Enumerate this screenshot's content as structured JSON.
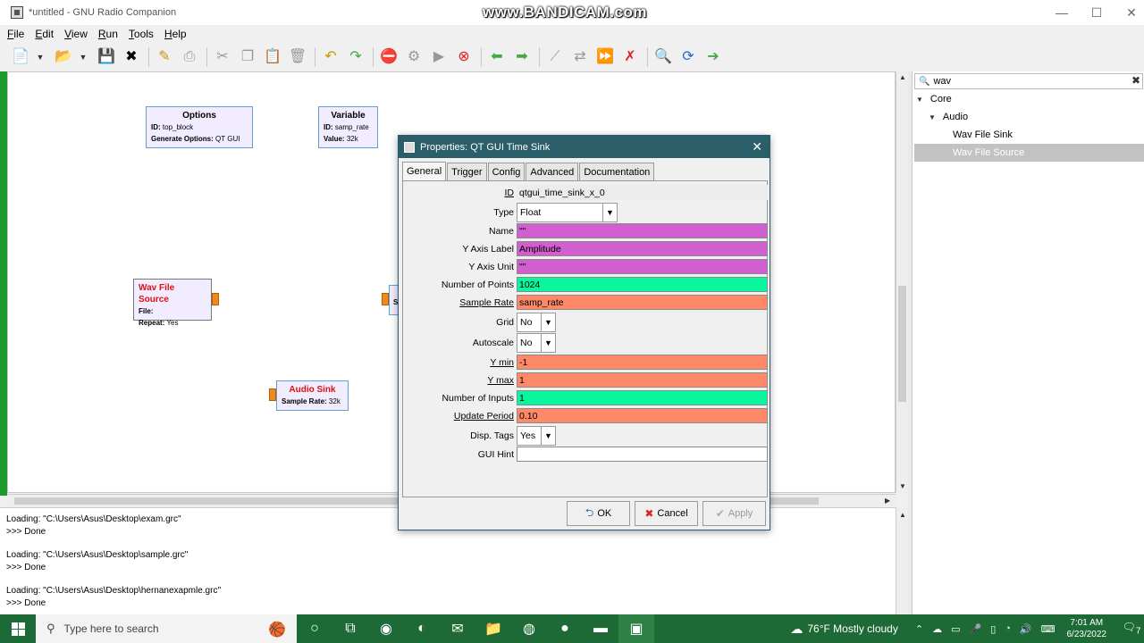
{
  "window": {
    "title": "*untitled - GNU Radio Companion",
    "watermark": "www.BANDICAM.com",
    "minimize_glyph": "—",
    "maximize_glyph": "☐",
    "close_glyph": "✕"
  },
  "menu": [
    "File",
    "Edit",
    "View",
    "Run",
    "Tools",
    "Help"
  ],
  "toolbar_icons": [
    "new-icon",
    "open-icon",
    "save-icon",
    "close-icon",
    "properties-icon",
    "print-icon",
    "cut-icon",
    "copy-icon",
    "paste-icon",
    "delete-icon",
    "undo-icon",
    "redo-icon",
    "stop-icon",
    "generate-icon",
    "run-icon",
    "kill-icon",
    "back-icon",
    "forward-icon",
    "disable-icon",
    "bypass-icon",
    "enable-icon",
    "error-icon",
    "find-icon",
    "reload-icon",
    "exit-icon"
  ],
  "blocks": {
    "options": {
      "title": "Options",
      "id_label": "ID:",
      "id_value": "top_block",
      "gen_label": "Generate Options:",
      "gen_value": "QT GUI"
    },
    "variable": {
      "title": "Variable",
      "id_label": "ID:",
      "id_value": "samp_rate",
      "value_label": "Value:",
      "value_value": "32k"
    },
    "wav_source": {
      "title": "Wav File Source",
      "file_label": "File:",
      "file_value": "",
      "repeat_label": "Repeat:",
      "repeat_value": "Yes"
    },
    "audio_sink": {
      "title": "Audio Sink",
      "rate_label": "Sample Rate:",
      "rate_value": "32k"
    },
    "partial": {
      "label": "S"
    }
  },
  "console": [
    "Loading: \"C:\\Users\\Asus\\Desktop\\exam.grc\"",
    ">>> Done",
    "Loading: \"C:\\Users\\Asus\\Desktop\\sample.grc\"",
    ">>> Done",
    "Loading: \"C:\\Users\\Asus\\Desktop\\hernanexapmle.grc\"",
    ">>> Done"
  ],
  "library": {
    "search_value": "wav",
    "tree": [
      {
        "label": "Core"
      },
      {
        "label": "Audio"
      },
      {
        "label": "Wav File Sink"
      },
      {
        "label": "Wav File Source"
      }
    ]
  },
  "dialog": {
    "title": "Properties: QT GUI Time Sink",
    "tabs": [
      "General",
      "Trigger",
      "Config",
      "Advanced",
      "Documentation"
    ],
    "active_tab": "General",
    "params": {
      "id": {
        "label": "ID",
        "value": "qtgui_time_sink_x_0"
      },
      "type": {
        "label": "Type",
        "value": "Float"
      },
      "name": {
        "label": "Name",
        "value": "\"\""
      },
      "y_axis_label": {
        "label": "Y Axis Label",
        "value": "Amplitude"
      },
      "y_axis_unit": {
        "label": "Y Axis Unit",
        "value": "\"\""
      },
      "num_points": {
        "label": "Number of Points",
        "value": "1024"
      },
      "sample_rate": {
        "label": "Sample Rate",
        "value": "samp_rate"
      },
      "grid": {
        "label": "Grid",
        "value": "No"
      },
      "autoscale": {
        "label": "Autoscale",
        "value": "No"
      },
      "y_min": {
        "label": "Y min",
        "value": "-1"
      },
      "y_max": {
        "label": "Y max",
        "value": "1"
      },
      "num_inputs": {
        "label": "Number of Inputs",
        "value": "1"
      },
      "update_period": {
        "label": "Update Period",
        "value": "0.10"
      },
      "disp_tags": {
        "label": "Disp. Tags",
        "value": "Yes"
      },
      "gui_hint": {
        "label": "GUI Hint",
        "value": ""
      }
    },
    "buttons": {
      "ok": "OK",
      "cancel": "Cancel",
      "apply": "Apply"
    }
  },
  "taskbar": {
    "search_placeholder": "Type here to search",
    "weather": "76°F  Mostly cloudy",
    "time": "7:01 AM",
    "date": "6/23/2022",
    "notification_count": "7"
  },
  "colors": {
    "canvas_bg": "#ffffff",
    "dialog_header": "#2a5f6a",
    "field_string": "#d15fd0",
    "field_int": "#08f79e",
    "field_float": "#fd8969",
    "block_bg": "#f1ecff",
    "block_error_title": "#e01010",
    "port": "#f18a1d",
    "taskbar": "#1d6a36"
  }
}
